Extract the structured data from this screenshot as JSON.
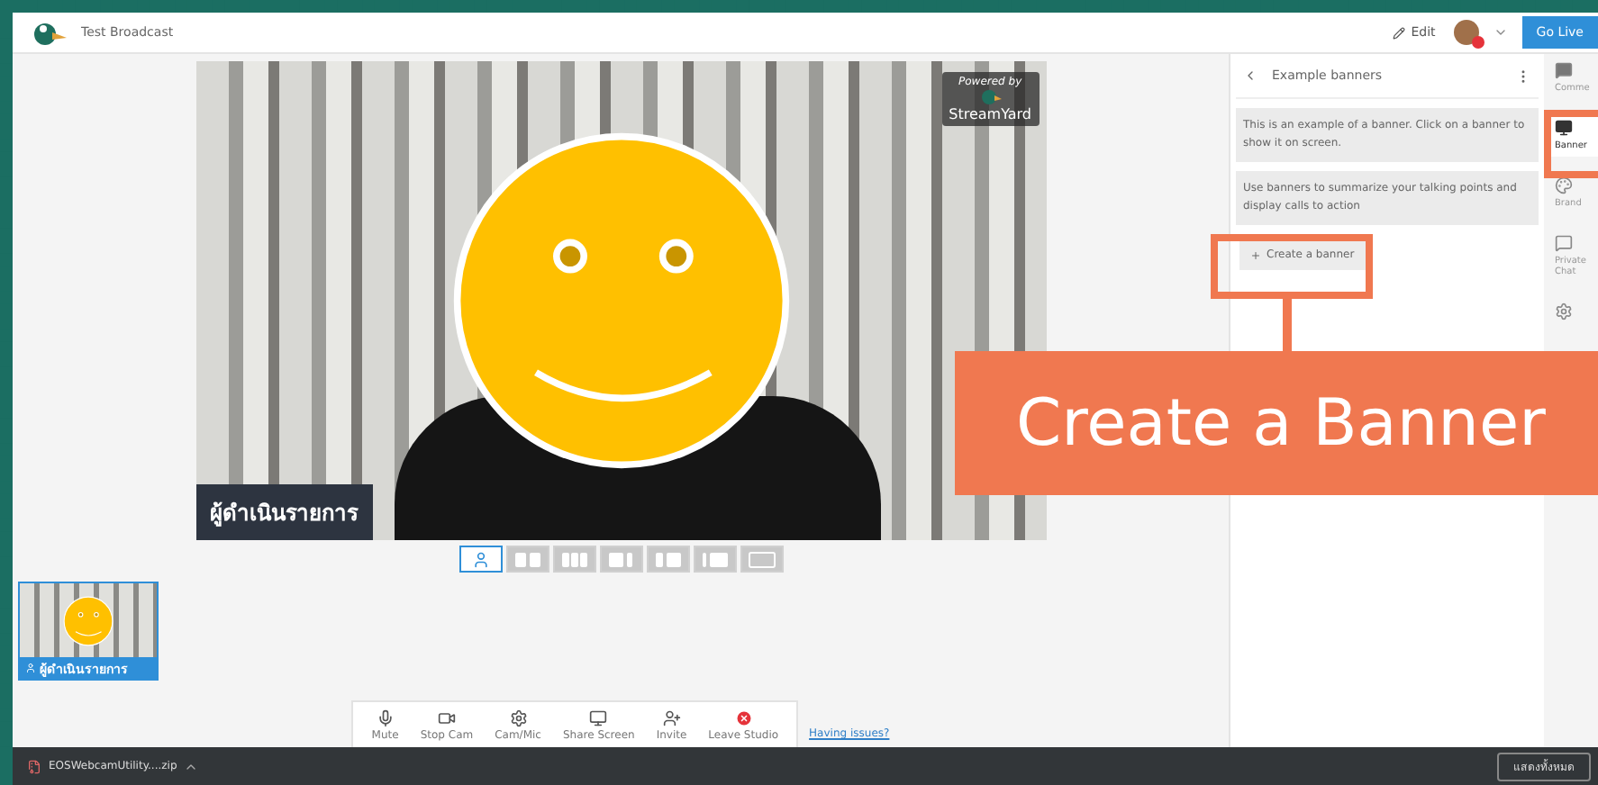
{
  "app_bar": {
    "title": "Test Broadcast",
    "edit": "Edit",
    "go_live": "Go Live"
  },
  "stage": {
    "name_tag": "ผู้ดำเนินรายการ",
    "powered": "Powered by",
    "brand": "StreamYard"
  },
  "layouts": [
    {
      "kind": "solo",
      "selected": true
    },
    {
      "kind": "pair",
      "selected": false
    },
    {
      "kind": "grid",
      "selected": false
    },
    {
      "kind": "group",
      "selected": false
    },
    {
      "kind": "side",
      "selected": false
    },
    {
      "kind": "thin",
      "selected": false
    },
    {
      "kind": "full",
      "selected": false
    }
  ],
  "guests": [
    {
      "name": "ผู้ดำเนินรายการ"
    }
  ],
  "controls": [
    {
      "kind": "mic",
      "label": "Mute"
    },
    {
      "kind": "cam",
      "label": "Stop Cam"
    },
    {
      "kind": "settings",
      "label": "Cam/Mic"
    },
    {
      "kind": "screen",
      "label": "Share Screen"
    },
    {
      "kind": "invite",
      "label": "Invite"
    },
    {
      "kind": "leave",
      "label": "Leave Studio"
    }
  ],
  "help_link": "Having issues?",
  "panel": {
    "title": "Example banners",
    "banners": [
      "This is an example of a banner. Click on a banner to show it on screen.",
      "Use banners to summarize your talking points and display calls to action"
    ],
    "create_button": "Create a banner"
  },
  "rail": [
    {
      "kind": "comments",
      "label": "Comme",
      "selected": false
    },
    {
      "kind": "banners",
      "label": "Banner",
      "selected": true
    },
    {
      "kind": "brand",
      "label": "Brand",
      "selected": false
    },
    {
      "kind": "chat",
      "label": "Private Chat",
      "selected": false
    },
    {
      "kind": "settings",
      "selected": false
    }
  ],
  "downloads": {
    "file": "EOSWebcamUtility....zip",
    "show_all": "แสดงทั้งหมด"
  },
  "annotation": {
    "text": "Create a Banner"
  }
}
